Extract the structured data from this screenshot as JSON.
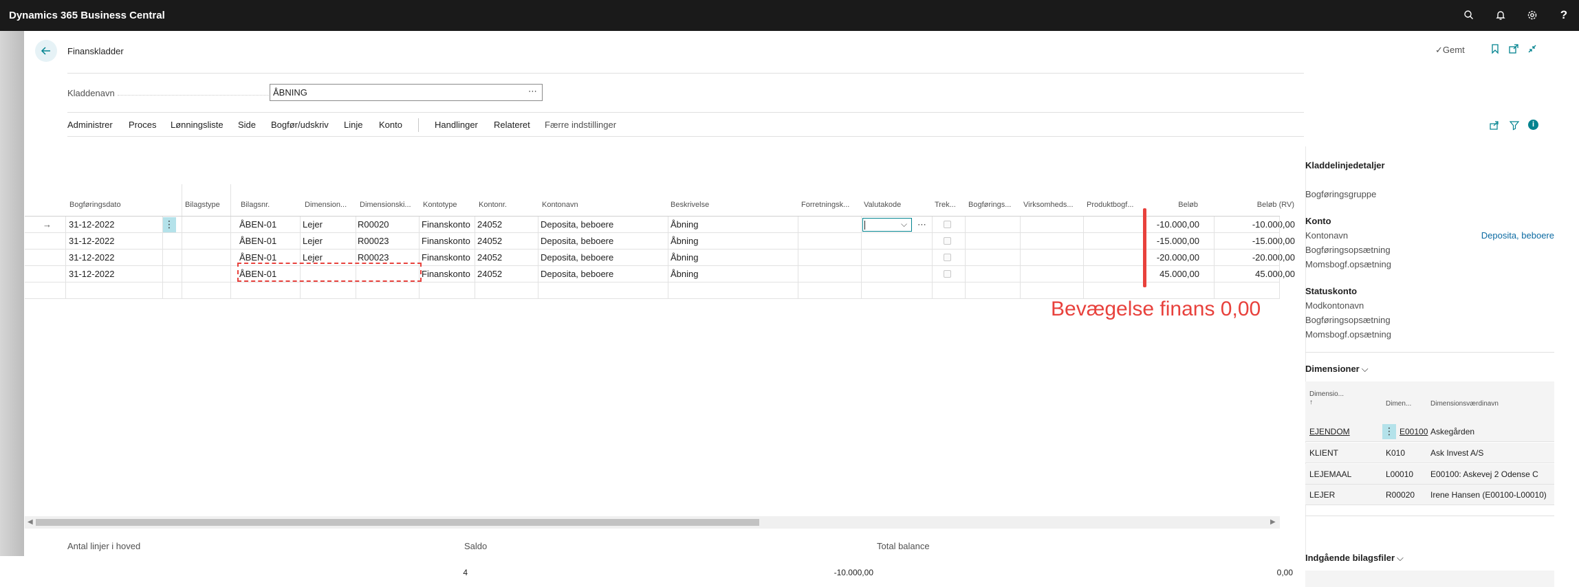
{
  "app": {
    "title": "Dynamics 365 Business Central"
  },
  "topbar_icons": [
    "search-icon",
    "bell-icon",
    "gear-icon",
    "help-icon"
  ],
  "page": {
    "title": "Finanskladder",
    "saved": "Gemt",
    "kladde_label": "Kladdenavn",
    "kladde_value": "ÅBNING",
    "kladde_more": "⋯"
  },
  "menu": [
    "Administrer",
    "Proces",
    "Lønningsliste",
    "Side",
    "Bogfør/udskriv",
    "Linje",
    "Konto",
    "Handlinger",
    "Relateret",
    "Færre indstillinger"
  ],
  "columns": [
    "Bogføringsdato",
    "Bilagstype",
    "Bilagsnr.",
    "Dimension...",
    "Dimensionski...",
    "Kontotype",
    "Kontonr.",
    "Kontonavn",
    "Beskrivelse",
    "Forretningsk...",
    "Valutakode",
    "Trek...",
    "Bogførings...",
    "Virksomheds...",
    "Produktbogf...",
    "Beløb",
    "Beløb (RV)"
  ],
  "rows": [
    {
      "date": "31-12-2022",
      "bilagsnr": "ÅBEN-01",
      "dim": "Lejer",
      "dimkode": "R00020",
      "kontotype": "Finanskonto",
      "kontonr": "24052",
      "kontonavn": "Deposita, beboere",
      "beskrivelse": "Åbning",
      "belob": "-10.000,00",
      "belob_rv": "-10.000,00"
    },
    {
      "date": "31-12-2022",
      "bilagsnr": "ÅBEN-01",
      "dim": "Lejer",
      "dimkode": "R00023",
      "kontotype": "Finanskonto",
      "kontonr": "24052",
      "kontonavn": "Deposita, beboere",
      "beskrivelse": "Åbning",
      "belob": "-15.000,00",
      "belob_rv": "-15.000,00"
    },
    {
      "date": "31-12-2022",
      "bilagsnr": "ÅBEN-01",
      "dim": "Lejer",
      "dimkode": "R00023",
      "kontotype": "Finanskonto",
      "kontonr": "24052",
      "kontonavn": "Deposita, beboere",
      "beskrivelse": "Åbning",
      "belob": "-20.000,00",
      "belob_rv": "-20.000,00"
    },
    {
      "date": "31-12-2022",
      "bilagsnr": "ÅBEN-01",
      "dim": "",
      "dimkode": "",
      "kontotype": "Finanskonto",
      "kontonr": "24052",
      "kontonavn": "Deposita, beboere",
      "beskrivelse": "Åbning",
      "belob": "45.000,00",
      "belob_rv": "45.000,00"
    }
  ],
  "annotation": {
    "text": "Bevægelse finans 0,00",
    "color": "#e8413c"
  },
  "footer": {
    "antal_label": "Antal linjer i hoved",
    "antal_value": "4",
    "saldo_label": "Saldo",
    "saldo_value": "-10.000,00",
    "total_label": "Total balance",
    "total_value": "0,00"
  },
  "factbox": {
    "title": "Kladdelinjedetaljer",
    "bogforingsgruppe": "Bogføringsgruppe",
    "konto_title": "Konto",
    "kontonavn_label": "Kontonavn",
    "kontonavn_value": "Deposita, beboere",
    "bogforingsopsaetning": "Bogføringsopsætning",
    "momsbogf": "Momsbogf.opsætning",
    "statuskonto_title": "Statuskonto",
    "modkontonavn": "Modkontonavn",
    "bogforingsopsaetning2": "Bogføringsopsætning",
    "momsbogf2": "Momsbogf.opsætning",
    "dimensioner_title": "Dimensioner",
    "dim_headers": [
      "Dimensio...",
      "Dimen...",
      "Dimensionsværdinavn"
    ],
    "dim_sort": "↑",
    "dim_rows": [
      {
        "code": "EJENDOM",
        "value": "E00100",
        "name": "Askegården"
      },
      {
        "code": "KLIENT",
        "value": "K010",
        "name": "Ask Invest A/S"
      },
      {
        "code": "LEJEMAAL",
        "value": "L00010",
        "name": "E00100: Askevej 2 Odense C"
      },
      {
        "code": "LEJER",
        "value": "R00020",
        "name": "Irene Hansen (E00100-L00010)"
      }
    ],
    "indgaende_title": "Indgående bilagsfiler"
  },
  "colors": {
    "accent": "#00838f",
    "link": "#0b6aa2",
    "topbar": "#1a1a1a",
    "selected": "#b4e2ea"
  }
}
